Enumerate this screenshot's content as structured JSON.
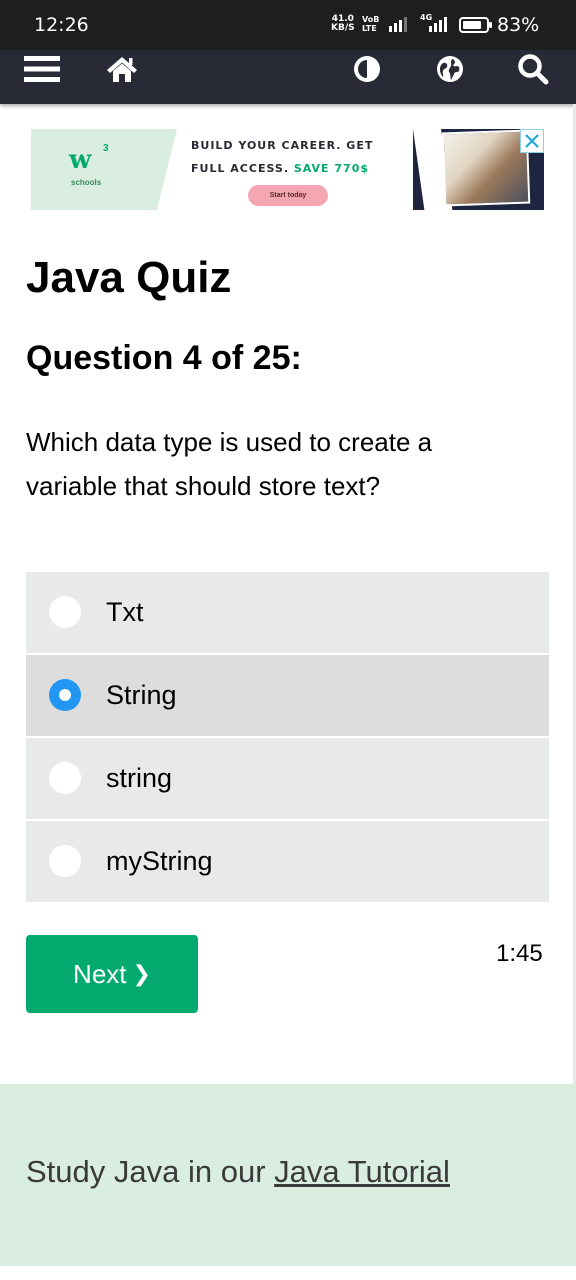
{
  "status_bar": {
    "time": "12:26",
    "net_speed_value": "41.0",
    "net_speed_unit": "KB/S",
    "volte_top": "VoB",
    "volte_bottom": "LTE",
    "network_type": "4G",
    "battery_percent": "83%",
    "battery_level": 0.83
  },
  "nav": {
    "icons": [
      "menu-icon",
      "home-icon",
      "contrast-icon",
      "globe-icon",
      "search-icon"
    ]
  },
  "ad": {
    "logo_text": "w",
    "logo_sup": "3",
    "logo_caption": "schools",
    "headline_line1": "BUILD YOUR CAREER. GET",
    "headline_line2": "FULL ACCESS.",
    "headline_save": "SAVE 770$",
    "cta": "Start today",
    "close_icon": "close-icon"
  },
  "quiz": {
    "title": "Java Quiz",
    "question_header": "Question 4 of 25:",
    "question": "Which data type is used to create a variable that should store text?",
    "options": [
      {
        "label": "Txt",
        "selected": false
      },
      {
        "label": "String",
        "selected": true
      },
      {
        "label": "string",
        "selected": false
      },
      {
        "label": "myString",
        "selected": false
      }
    ],
    "next_label": "Next",
    "next_arrow": "❯",
    "timer": "1:45"
  },
  "footer": {
    "text": "Study Java in our",
    "link": "Java Tutorial"
  },
  "colors": {
    "accent_green": "#04aa6d",
    "navbar_bg": "#282a35",
    "option_bg": "#e7e9eb",
    "radio_checked": "#2196f3",
    "footer_bg": "#d9eee1"
  }
}
